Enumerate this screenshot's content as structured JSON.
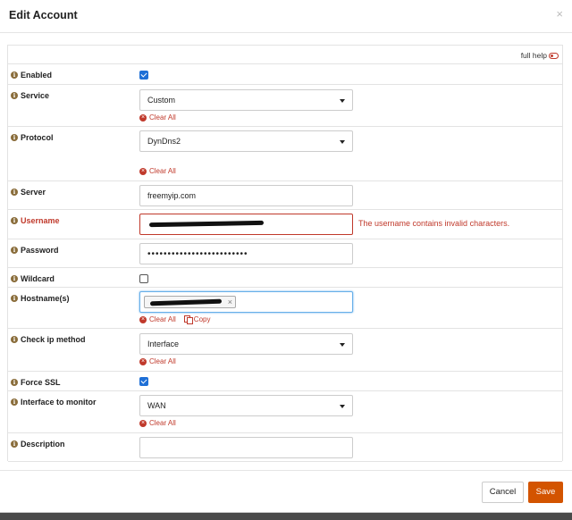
{
  "modal": {
    "title": "Edit Account",
    "close": "×"
  },
  "full_help": {
    "label": "full help"
  },
  "clear_all": "Clear All",
  "copy": "Copy",
  "fields": {
    "enabled": {
      "label": "Enabled",
      "checked": true
    },
    "service": {
      "label": "Service",
      "value": "Custom"
    },
    "protocol": {
      "label": "Protocol",
      "value": "DynDns2"
    },
    "server": {
      "label": "Server",
      "value": "freemyip.com"
    },
    "username": {
      "label": "Username",
      "error": "The username contains invalid characters."
    },
    "password": {
      "label": "Password",
      "value": "•••••••••••••••••••••••••"
    },
    "wildcard": {
      "label": "Wildcard",
      "checked": false
    },
    "hostnames": {
      "label": "Hostname(s)"
    },
    "check_ip": {
      "label": "Check ip method",
      "value": "Interface"
    },
    "force_ssl": {
      "label": "Force SSL",
      "checked": true
    },
    "interface": {
      "label": "Interface to monitor",
      "value": "WAN"
    },
    "description": {
      "label": "Description",
      "value": ""
    }
  },
  "buttons": {
    "cancel": "Cancel",
    "save": "Save"
  },
  "colors": {
    "error": "#c0392b",
    "accent": "#d35400",
    "check": "#1e6fd6"
  }
}
